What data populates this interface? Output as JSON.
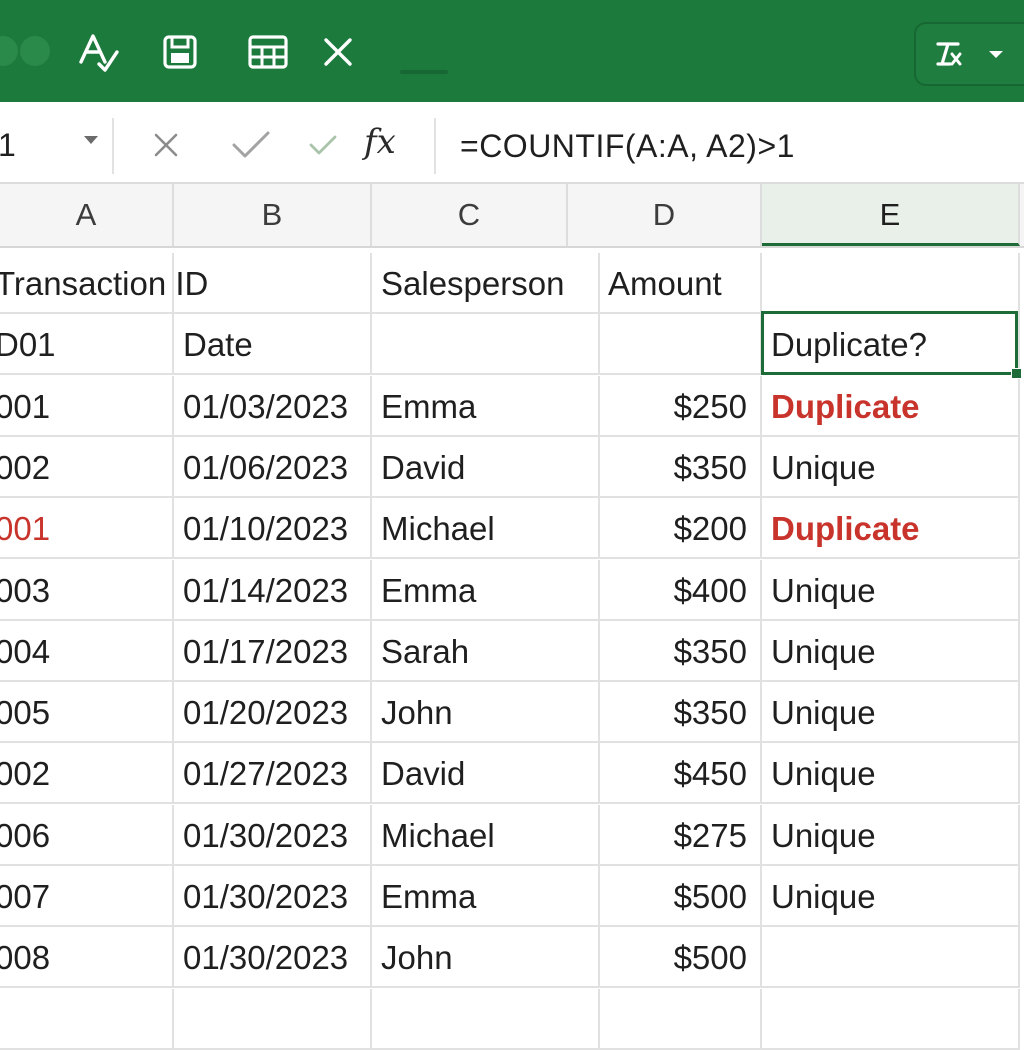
{
  "ribbon": {
    "tools": [
      "spelling-icon",
      "save-icon",
      "table-icon",
      "close-icon"
    ],
    "right_tools": [
      "clear-format-icon",
      "dropdown-caret-icon"
    ]
  },
  "formula_bar": {
    "name_box": "1",
    "fx_label": "fx",
    "formula": "=COUNTIF(A:A, A2)>1"
  },
  "columns": [
    "A",
    "B",
    "C",
    "D",
    "E"
  ],
  "rows": [
    {
      "a": "Transaction ID",
      "b": "",
      "c": "Salesperson",
      "d": "Amount",
      "e": ""
    },
    {
      "a": "D01",
      "b": "Date",
      "c": "",
      "d": "",
      "e": "Duplicate?"
    },
    {
      "a": "001",
      "b": "01/03/2023",
      "c": "Emma",
      "d": "$250",
      "e": "Duplicate"
    },
    {
      "a": "002",
      "b": "01/06/2023",
      "c": "David",
      "d": "$350",
      "e": "Unique"
    },
    {
      "a": "001",
      "b": "01/10/2023",
      "c": "Michael",
      "d": "$200",
      "e": "Duplicate"
    },
    {
      "a": "003",
      "b": "01/14/2023",
      "c": "Emma",
      "d": "$400",
      "e": "Unique"
    },
    {
      "a": "004",
      "b": "01/17/2023",
      "c": "Sarah",
      "d": "$350",
      "e": "Unique"
    },
    {
      "a": "005",
      "b": "01/20/2023",
      "c": "John",
      "d": "$350",
      "e": "Unique"
    },
    {
      "a": "002",
      "b": "01/27/2023",
      "c": "David",
      "d": "$450",
      "e": "Unique"
    },
    {
      "a": "006",
      "b": "01/30/2023",
      "c": "Michael",
      "d": "$275",
      "e": "Unique"
    },
    {
      "a": "007",
      "b": "01/30/2023",
      "c": "Emma",
      "d": "$500",
      "e": "Unique"
    },
    {
      "a": "008",
      "b": "01/30/2023",
      "c": "John",
      "d": "$500",
      "e": ""
    },
    {
      "a": "",
      "b": "",
      "c": "",
      "d": "",
      "e": ""
    }
  ],
  "colors": {
    "ribbon": "#1d7a3d",
    "selection": "#1d6b36",
    "duplicate": "#c8332b"
  }
}
